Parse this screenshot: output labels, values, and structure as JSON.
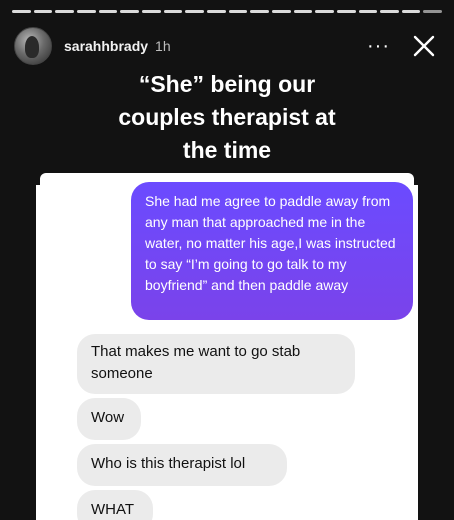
{
  "story": {
    "progress_segments": 20,
    "user": {
      "username": "sarahhbrady",
      "time_ago": "1h",
      "avatar_icon": "profile-avatar"
    },
    "icons": {
      "more": "more-options-icon",
      "close": "close-icon"
    },
    "more_glyph": "···",
    "caption_lines": [
      "“She” being our",
      "couples therapist at",
      "the time"
    ]
  },
  "messages": [
    {
      "direction": "outgoing",
      "text": "She had me agree to paddle away from any man that approached me in the water, no matter his age,I was instructed to say “I’m going to go talk to my boyfriend” and then paddle away",
      "color": "#6d4bf8"
    },
    {
      "direction": "incoming",
      "text": "That makes me want to go stab someone"
    },
    {
      "direction": "incoming",
      "text": "Wow"
    },
    {
      "direction": "incoming",
      "text": "Who is this therapist lol"
    },
    {
      "direction": "incoming",
      "text": "WHAT"
    }
  ]
}
